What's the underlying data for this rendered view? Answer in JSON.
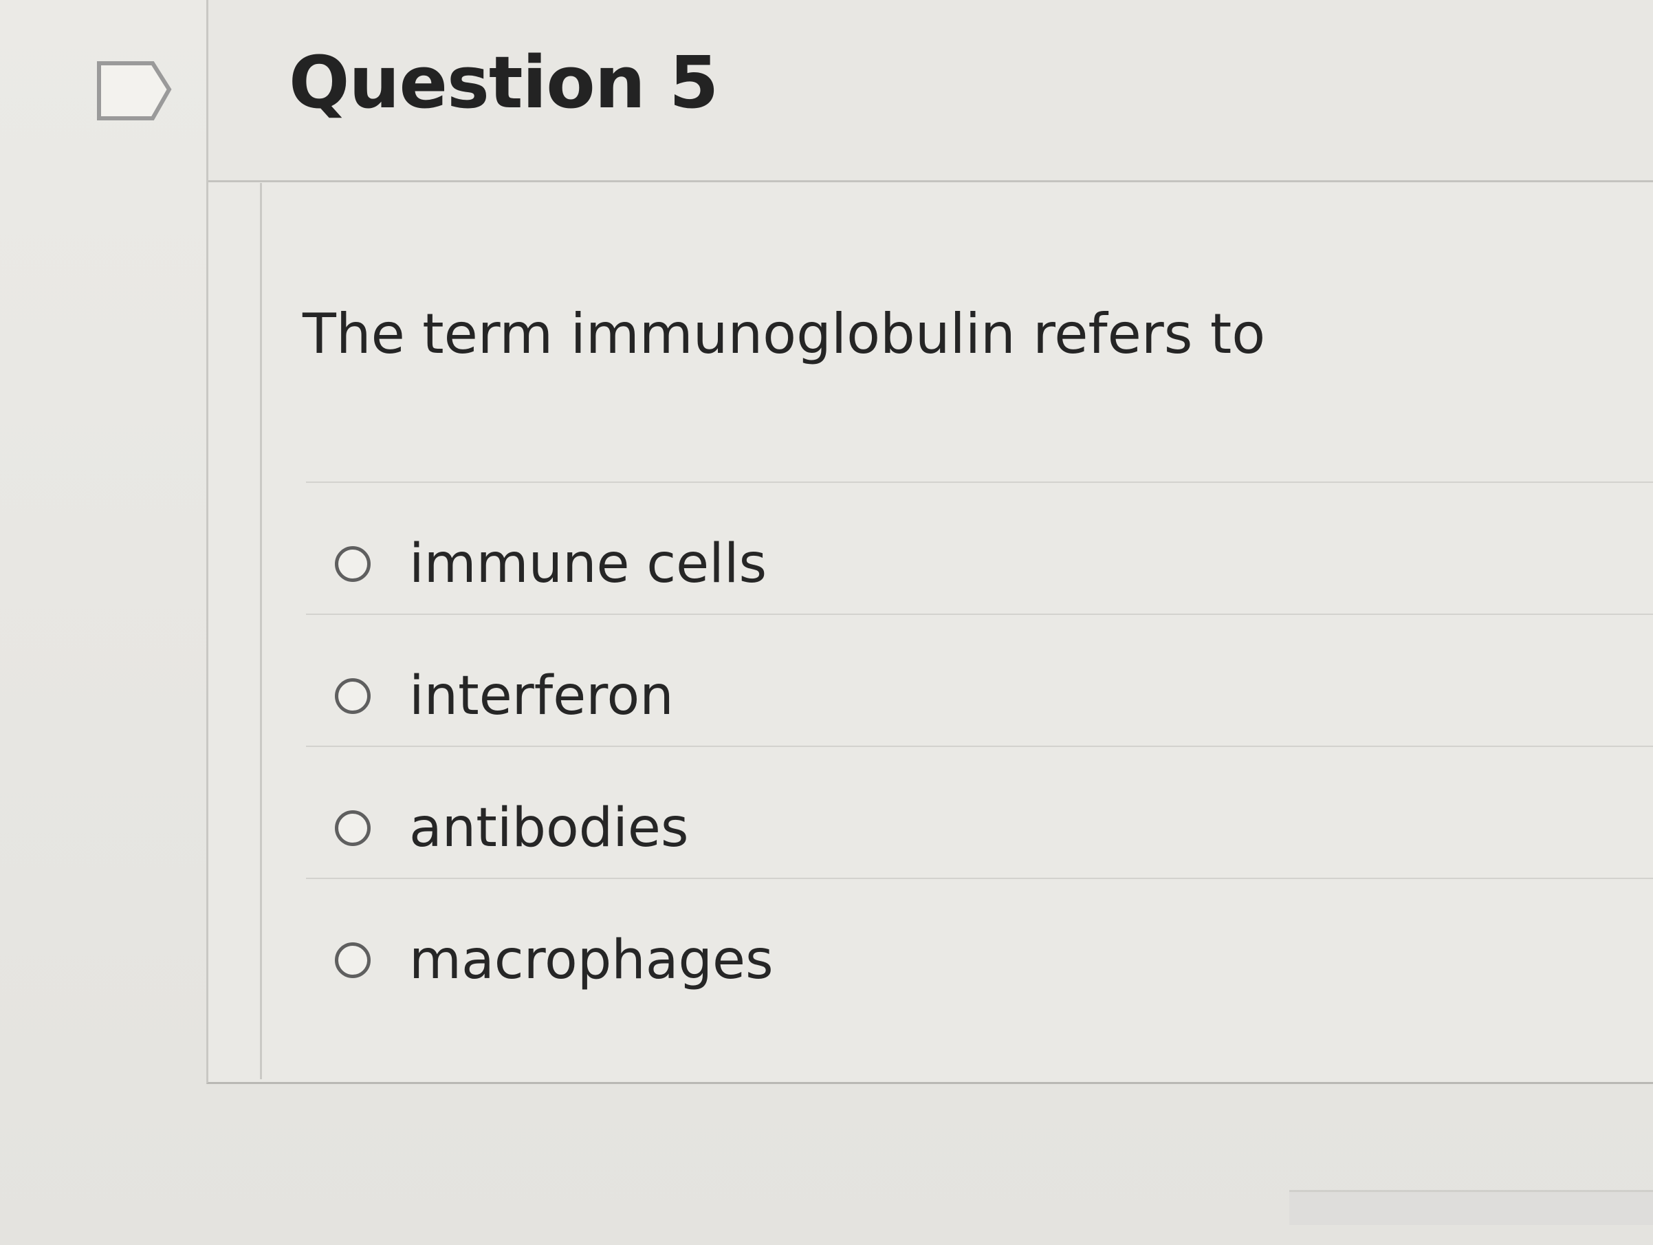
{
  "question": {
    "title": "Question 5",
    "prompt": "The term immunoglobulin refers to",
    "flag_icon": "flag-bookmark-icon",
    "radio_icon": "radio-empty-icon",
    "answers": [
      {
        "label": "immune cells"
      },
      {
        "label": "interferon"
      },
      {
        "label": "antibodies"
      },
      {
        "label": "macrophages"
      }
    ]
  }
}
